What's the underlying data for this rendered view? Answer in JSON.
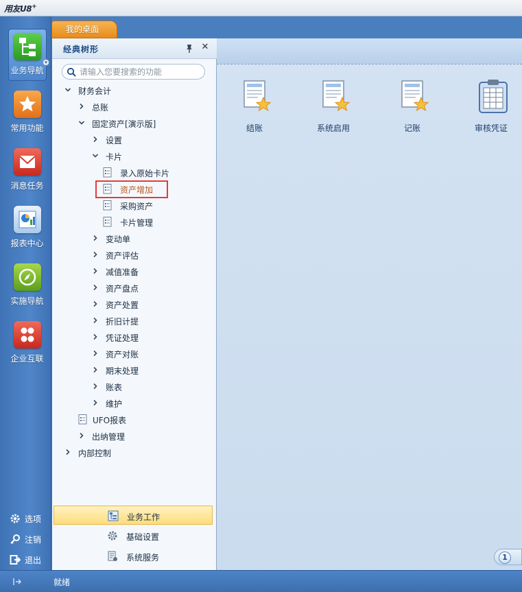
{
  "app": {
    "title": "用友U8",
    "title_sup": "+"
  },
  "leftnav": {
    "items": [
      {
        "label": "业务导航",
        "icon": "tree-nav-icon",
        "active": true
      },
      {
        "label": "常用功能",
        "icon": "star-icon"
      },
      {
        "label": "消息任务",
        "icon": "envelope-icon"
      },
      {
        "label": "报表中心",
        "icon": "report-chart-icon"
      },
      {
        "label": "实施导航",
        "icon": "compass-icon"
      },
      {
        "label": "企业互联",
        "icon": "link-icon"
      }
    ],
    "tools": [
      {
        "label": "选项",
        "icon": "gear-icon"
      },
      {
        "label": "注销",
        "icon": "key-icon"
      },
      {
        "label": "退出",
        "icon": "exit-icon"
      }
    ]
  },
  "tabs": {
    "desktop_label": "我的桌面"
  },
  "tree": {
    "title": "经典树形",
    "search_placeholder": "请输入您要搜索的功能",
    "nodes": [
      {
        "label": "财务会计",
        "state": "open",
        "level": 0
      },
      {
        "label": "总账",
        "state": "closed",
        "level": 1
      },
      {
        "label": "固定资产[演示版]",
        "state": "open",
        "level": 1
      },
      {
        "label": "设置",
        "state": "closed",
        "level": 2
      },
      {
        "label": "卡片",
        "state": "open",
        "level": 2
      },
      {
        "label": "录入原始卡片",
        "state": "leaf",
        "level": 3
      },
      {
        "label": "资产增加",
        "state": "leaf",
        "level": 3,
        "selected": true
      },
      {
        "label": "采购资产",
        "state": "leaf",
        "level": 3
      },
      {
        "label": "卡片管理",
        "state": "leaf",
        "level": 3
      },
      {
        "label": "变动单",
        "state": "closed",
        "level": 2
      },
      {
        "label": "资产评估",
        "state": "closed",
        "level": 2
      },
      {
        "label": "减值准备",
        "state": "closed",
        "level": 2
      },
      {
        "label": "资产盘点",
        "state": "closed",
        "level": 2
      },
      {
        "label": "资产处置",
        "state": "closed",
        "level": 2
      },
      {
        "label": "折旧计提",
        "state": "closed",
        "level": 2
      },
      {
        "label": "凭证处理",
        "state": "closed",
        "level": 2
      },
      {
        "label": "资产对账",
        "state": "closed",
        "level": 2
      },
      {
        "label": "期末处理",
        "state": "closed",
        "level": 2
      },
      {
        "label": "账表",
        "state": "closed",
        "level": 2
      },
      {
        "label": "维护",
        "state": "closed",
        "level": 2
      },
      {
        "label": "UFO报表",
        "state": "leaf",
        "level": 1
      },
      {
        "label": "出纳管理",
        "state": "closed",
        "level": 1
      },
      {
        "label": "内部控制",
        "state": "closed",
        "level": 0
      }
    ],
    "bottom_buttons": [
      {
        "label": "业务工作",
        "active": true
      },
      {
        "label": "基础设置"
      },
      {
        "label": "系统服务"
      }
    ]
  },
  "desktop": {
    "icons": [
      {
        "label": "结账"
      },
      {
        "label": "系统启用"
      },
      {
        "label": "记账"
      },
      {
        "label": "审核凭证"
      }
    ],
    "page": "1"
  },
  "status": {
    "text": "就绪"
  }
}
